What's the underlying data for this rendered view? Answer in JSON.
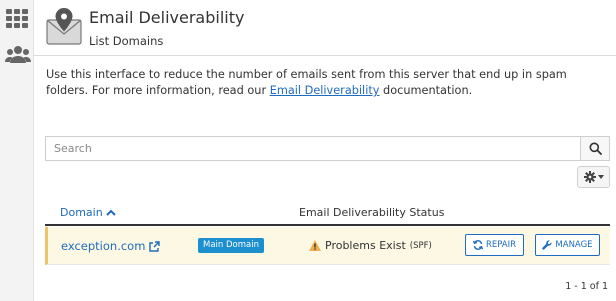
{
  "page": {
    "title": "Email Deliverability",
    "subtitle": "List Domains"
  },
  "description": {
    "before": "Use this interface to reduce the number of emails sent from this server that end up in spam folders. For more information, read our ",
    "link_text": "Email Deliverability",
    "after": " documentation."
  },
  "search": {
    "placeholder": "Search",
    "value": ""
  },
  "table": {
    "headers": {
      "domain": "Domain",
      "status": "Email Deliverability Status"
    },
    "rows": [
      {
        "domain": "exception.com",
        "badge": "Main Domain",
        "status": "Problems Exist",
        "status_detail": "(SPF)",
        "repair_label": "REPAIR",
        "manage_label": "MANAGE"
      }
    ]
  },
  "pagination": {
    "range": "1 - 1 of 1"
  },
  "colors": {
    "link": "#1f6bbf",
    "badge": "#1c8fce",
    "warning_row": "#fcf8e3",
    "warning_icon": "#f0ad4e"
  },
  "icons": {
    "sidebar": [
      "grid-icon",
      "users-icon"
    ],
    "header": "envelope-icon",
    "search": "search-icon",
    "settings": "gear-icon",
    "sort": "chevron-up-icon",
    "external": "external-link-icon",
    "warning": "warning-icon",
    "repair": "refresh-icon",
    "manage": "wrench-icon"
  }
}
